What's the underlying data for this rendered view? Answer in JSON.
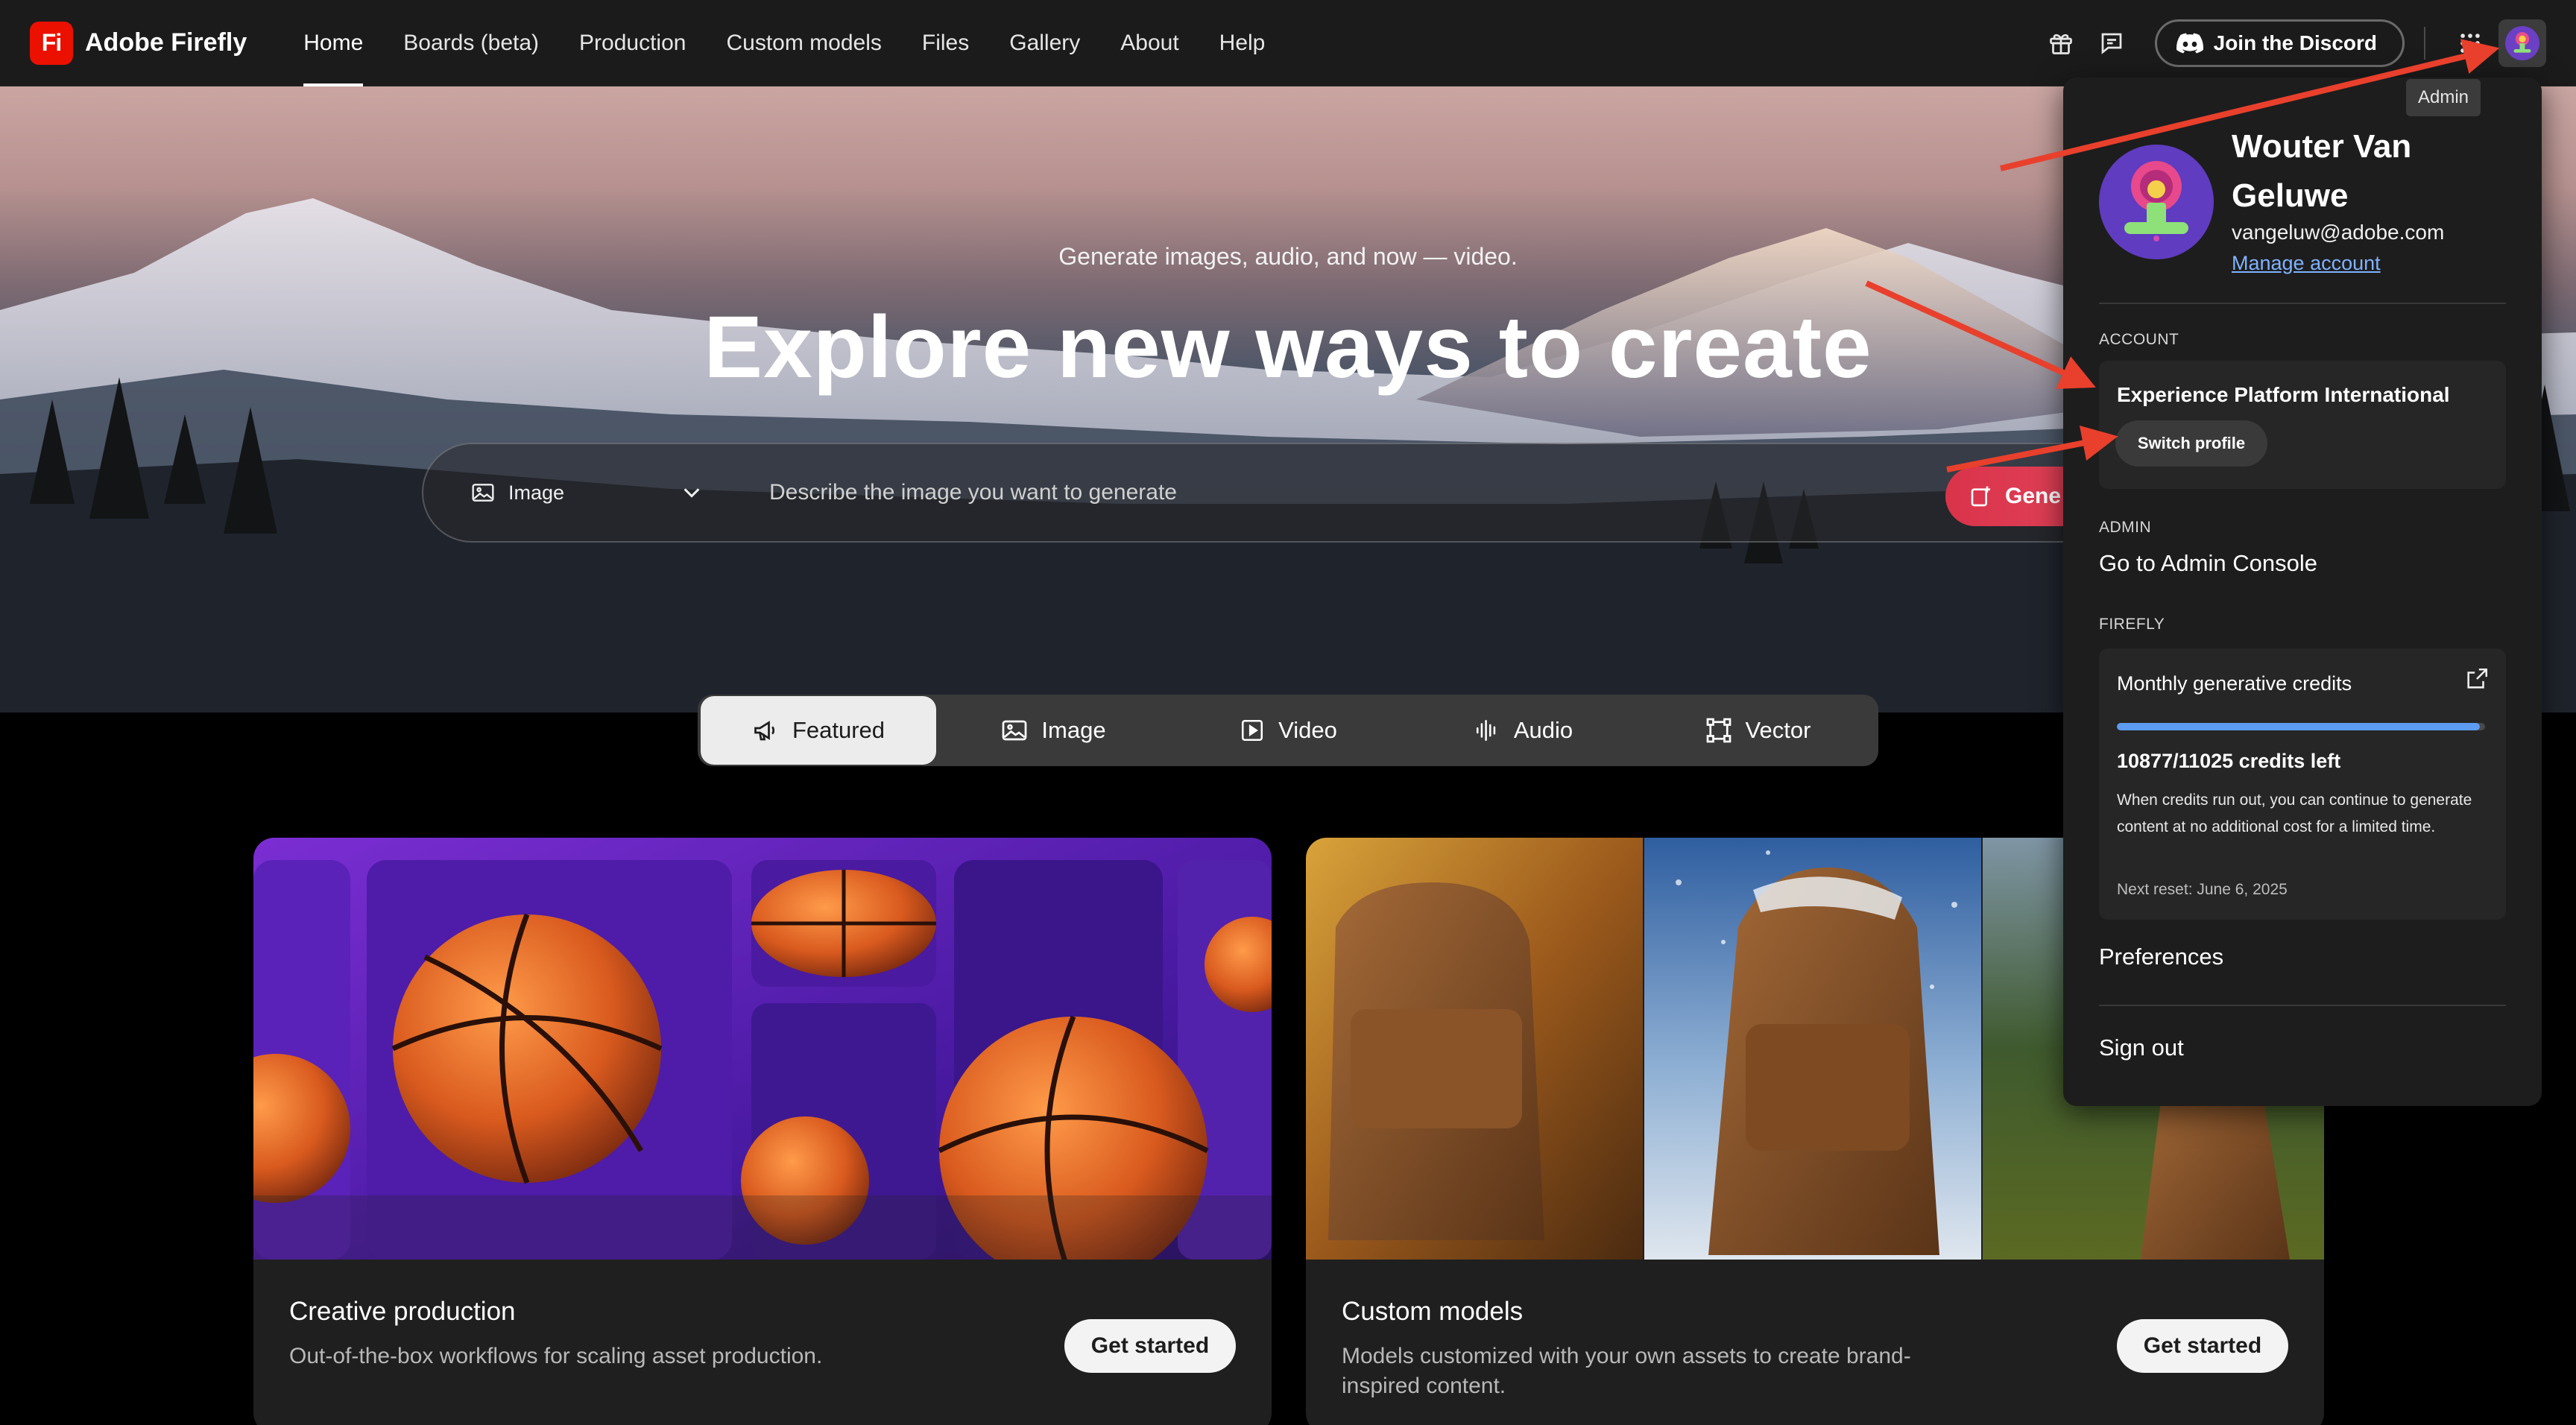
{
  "app": {
    "logo_letter": "Fi",
    "name": "Adobe Firefly"
  },
  "nav": {
    "links": [
      "Home",
      "Boards (beta)",
      "Production",
      "Custom models",
      "Files",
      "Gallery",
      "About",
      "Help"
    ],
    "active": "Home",
    "discord_label": "Join the Discord",
    "tooltip": "Admin",
    "icons": [
      "gift-icon",
      "chat-icon",
      "discord-icon",
      "app-grid-icon",
      "avatar"
    ]
  },
  "hero": {
    "subtitle": "Generate images, audio, and now — video.",
    "title": "Explore new ways to create",
    "type_select": "Image",
    "prompt_placeholder": "Describe the image you want to generate",
    "generate_label": "Gene"
  },
  "tabs": [
    "Featured",
    "Image",
    "Video",
    "Audio",
    "Vector"
  ],
  "active_tab": "Featured",
  "cards": [
    {
      "title": "Creative production",
      "description": "Out-of-the-box workflows for scaling asset production.",
      "button": "Get started"
    },
    {
      "title": "Custom models",
      "description": "Models customized with your own assets to create brand-inspired content.",
      "button": "Get started"
    }
  ],
  "account_panel": {
    "name": "Wouter Van Geluwe",
    "email": "vangeluw@adobe.com",
    "manage_link": "Manage account",
    "account_label": "ACCOUNT",
    "org_name": "Experience Platform International",
    "switch_profile": "Switch profile",
    "admin_label": "ADMIN",
    "admin_console": "Go to Admin Console",
    "firefly_label": "FIREFLY",
    "credits_title": "Monthly generative credits",
    "credits_used": 10877,
    "credits_total": 11025,
    "credits_fraction": 0.9866,
    "credits_text": "10877/11025 credits left",
    "credits_note": "When credits run out, you can continue to generate content at no additional cost for a limited time.",
    "credits_reset": "Next reset: June 6, 2025",
    "preferences": "Preferences",
    "sign_out": "Sign out"
  },
  "colors": {
    "brand": "#eb1000",
    "accent_link": "#7fb2ff",
    "credits_bar": "#5c9cf2",
    "annotation_arrow": "#e8402c"
  }
}
